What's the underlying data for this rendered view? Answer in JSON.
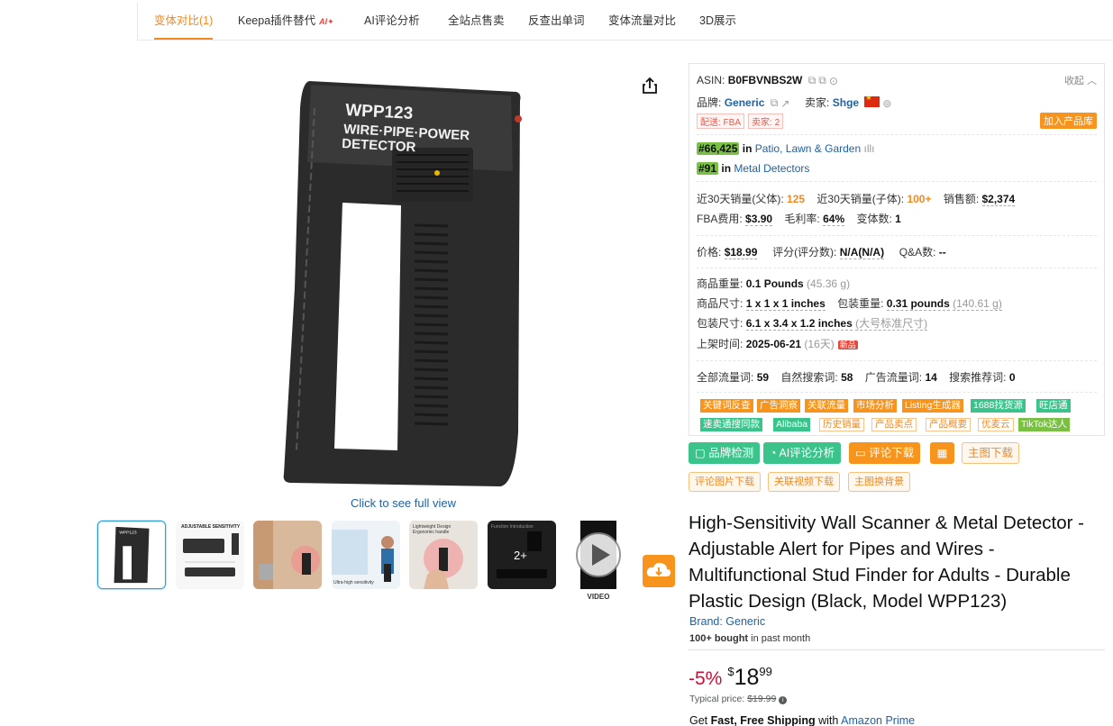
{
  "tabs": [
    {
      "label": "变体对比(1)",
      "active": true
    },
    {
      "label": "Keepa插件替代",
      "badge": "AI"
    },
    {
      "label": "AI评论分析"
    },
    {
      "label": "全站点售卖"
    },
    {
      "label": "反查出单词"
    },
    {
      "label": "变体流量对比"
    },
    {
      "label": "3D展示"
    }
  ],
  "gallery": {
    "full_view_link": "Click to see full view",
    "overlay_count": "2+",
    "video_label": "VIDEO",
    "product_print": {
      "l1": "WPP123",
      "l2": "WIRE·PIPE·POWER",
      "l3": "DETECTOR"
    },
    "thumb_texts": {
      "t2": "ADJUSTABLE SENSITIVITY",
      "t4": "Ultra-high sensitivity",
      "t5a": "Lightweight Design",
      "t5b": "Ergonomic handle",
      "t6": "Function Introduction"
    }
  },
  "panel": {
    "asin_label": "ASIN:",
    "asin": "B0FBVNBS2W",
    "collapse": "收起",
    "brand_label": "品牌:",
    "brand": "Generic",
    "seller_label": "卖家:",
    "seller": "Shge",
    "tag_fba": "配送: FBA",
    "tag_sellers": "卖家: 2",
    "add_library": "加入产品库",
    "rank1": "#66,425",
    "rank1_in": "in",
    "rank1_cat": "Patio, Lawn & Garden",
    "rank2": "#91",
    "rank2_in": "in",
    "rank2_cat": "Metal Detectors",
    "sales_parent_label": "近30天销量(父体):",
    "sales_parent": "125",
    "sales_child_label": "近30天销量(子体):",
    "sales_child": "100+",
    "revenue_label": "销售额:",
    "revenue": "$2,374",
    "fba_label": "FBA费用:",
    "fba": "$3.90",
    "margin_label": "毛利率:",
    "margin": "64%",
    "variants_label": "变体数:",
    "variants": "1",
    "price_label": "价格:",
    "price": "$18.99",
    "rating_label": "评分(评分数):",
    "rating": "N/A(N/A)",
    "qa_label": "Q&A数:",
    "qa": "--",
    "weight_label": "商品重量:",
    "weight": "0.1 Pounds",
    "weight_g": "(45.36 g)",
    "size_label": "商品尺寸:",
    "size": "1 x 1 x 1 inches",
    "pkg_weight_label": "包装重量:",
    "pkg_weight": "0.31 pounds",
    "pkg_weight_g": "(140.61 g)",
    "pkg_size_label": "包装尺寸:",
    "pkg_size": "6.1 x 3.4 x 1.2 inches",
    "pkg_size_note": "(大号标准尺寸)",
    "listed_label": "上架时间:",
    "listed": "2025-06-21",
    "listed_days": "(16天)",
    "new_badge": "新品",
    "all_kw_label": "全部流量词:",
    "all_kw": "59",
    "organic_kw_label": "自然搜索词:",
    "organic_kw": "58",
    "ad_kw_label": "广告流量词:",
    "ad_kw": "14",
    "rec_kw_label": "搜索推荐词:",
    "rec_kw": "0",
    "chips": [
      "关键词反查",
      "广告洞察",
      "关联流量",
      "市场分析",
      "Listing生成器",
      "1688找货源",
      "旺店通",
      "速卖通搜同款",
      "Alibaba",
      "历史销量",
      "产品卖点",
      "产品概要",
      "优麦云",
      "TikTok达人"
    ]
  },
  "actions": {
    "brand_check": "品牌检测",
    "ai_review": "AI评论分析",
    "review_download": "评论下载",
    "main_image_download": "主图下载",
    "review_image_download": "评论图片下载",
    "related_video_download": "关联视频下载",
    "main_image_bg": "主图换背景"
  },
  "product": {
    "title": "High-Sensitivity Wall Scanner & Metal Detector - Adjustable Alert for Pipes and Wires - Multifunctional Stud Finder for Adults - Durable Plastic Design (Black, Model WPP123)",
    "brand_link": "Brand: Generic",
    "bought_bold": "100+ bought",
    "bought_rest": " in past month",
    "discount": "-5%",
    "currency": "$",
    "price_whole": "18",
    "price_fraction": "99",
    "typical_label": "Typical price: ",
    "typical_price": "$19.99",
    "ship_get": "Get ",
    "ship_bold": "Fast, Free Shipping",
    "ship_with": " with ",
    "ship_prime": "Amazon Prime"
  },
  "colors": {
    "accent": "#f08a24",
    "link": "#2162a1",
    "green": "#3ac48b",
    "rank": "#7ac143",
    "deal": "#cc0c39"
  }
}
